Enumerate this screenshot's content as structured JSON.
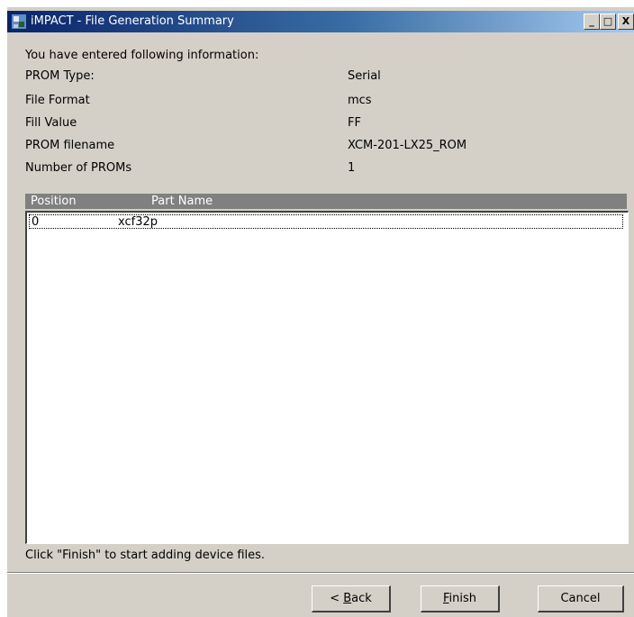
{
  "window": {
    "title": "iMPACT - File Generation Summary",
    "controls": {
      "minimize": "_",
      "maximize": "□",
      "close": "X"
    }
  },
  "summary": {
    "intro": "You have entered following information:",
    "rows": [
      {
        "label": "PROM Type:",
        "value": "Serial"
      },
      {
        "label": "File Format",
        "value": "mcs"
      },
      {
        "label": "Fill Value",
        "value": "FF"
      },
      {
        "label": "PROM filename",
        "value": "XCM-201-LX25_ROM"
      },
      {
        "label": "Number of PROMs",
        "value": "1"
      }
    ]
  },
  "table": {
    "columns": [
      "Position",
      "Part Name"
    ],
    "rows": [
      {
        "position": "0",
        "part_name": "xcf32p"
      }
    ]
  },
  "footer_note": "Click \"Finish\" to start adding device files.",
  "buttons": {
    "back": {
      "prefix": "< ",
      "mnemonic": "B",
      "rest": "ack"
    },
    "finish": {
      "mnemonic": "F",
      "rest": "inish"
    },
    "cancel": "Cancel"
  },
  "colors": {
    "titlebar_start": "#0a246a",
    "titlebar_end": "#a6caf0",
    "face": "#d4d0c8",
    "header": "#808080"
  }
}
